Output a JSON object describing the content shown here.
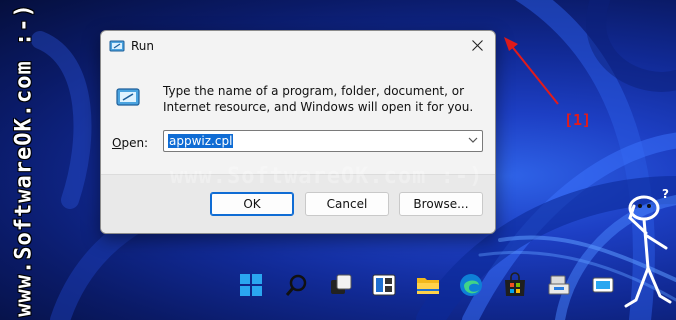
{
  "watermark": {
    "side": "www.SoftwareOK.com :-)",
    "center": "www.SoftwareOK.com :-)"
  },
  "annotation": {
    "label": "[1]",
    "color": "#e21b1b"
  },
  "dialog": {
    "title": "Run",
    "description": "Type the name of a program, folder, document, or Internet resource, and Windows will open it for you.",
    "open_label_prefix": "O",
    "open_label_rest": "pen:",
    "open_value": "appwiz.cpl",
    "buttons": {
      "ok": "OK",
      "cancel": "Cancel",
      "browse": "Browse..."
    }
  },
  "taskbar": {
    "icons": [
      "windows-start-icon",
      "search-icon",
      "task-view-icon",
      "widgets-icon",
      "file-explorer-icon",
      "edge-icon",
      "store-icon",
      "app-icon",
      "app-icon-2"
    ]
  },
  "colors": {
    "accent": "#0f6cd4",
    "dialog_bg": "#f3f3f3",
    "footer_bg": "#e9e9e9",
    "wallpaper": "#1d3fc4"
  }
}
